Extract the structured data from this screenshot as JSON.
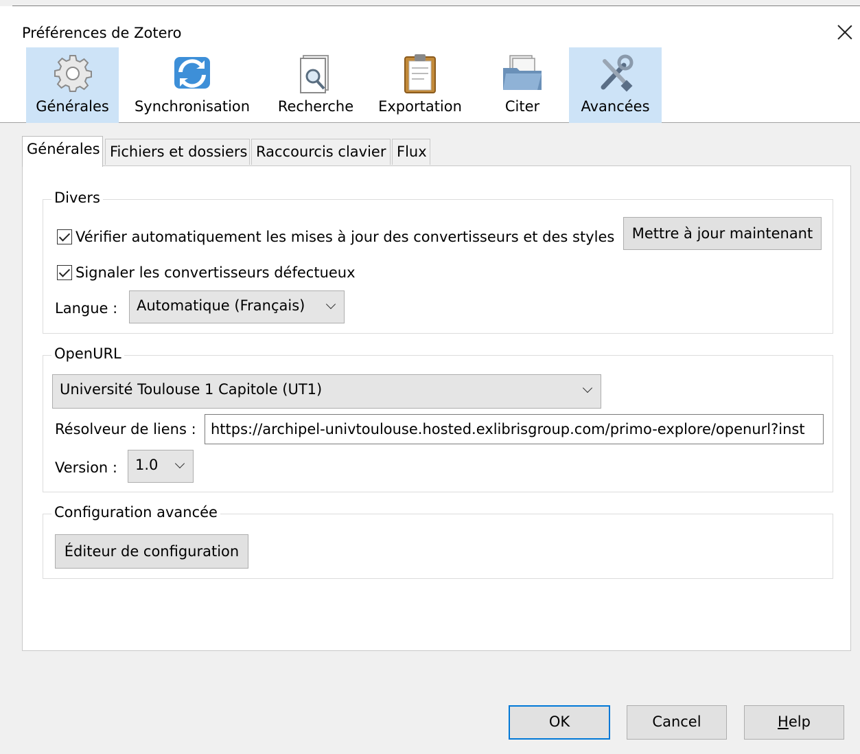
{
  "window": {
    "title": "Préférences de Zotero"
  },
  "panes": [
    {
      "label": "Générales",
      "icon": "gear-icon",
      "selected": true
    },
    {
      "label": "Synchronisation",
      "icon": "sync-icon",
      "selected": false
    },
    {
      "label": "Recherche",
      "icon": "search-document-icon",
      "selected": false
    },
    {
      "label": "Exportation",
      "icon": "clipboard-icon",
      "selected": false
    },
    {
      "label": "Citer",
      "icon": "folder-icon",
      "selected": false
    },
    {
      "label": "Avancées",
      "icon": "tools-icon",
      "selected": true
    }
  ],
  "tabs": [
    {
      "label": "Générales",
      "active": true
    },
    {
      "label": "Fichiers et dossiers",
      "active": false
    },
    {
      "label": "Raccourcis clavier",
      "active": false
    },
    {
      "label": "Flux",
      "active": false
    }
  ],
  "divers": {
    "legend": "Divers",
    "auto_update_label": "Vérifier automatiquement les mises à jour des convertisseurs et des styles",
    "auto_update_checked": true,
    "update_now_button": "Mettre à jour maintenant",
    "report_broken_label": "Signaler les convertisseurs défectueux",
    "report_broken_checked": true,
    "language_label": "Langue :",
    "language_value": "Automatique (Français)"
  },
  "openurl": {
    "legend": "OpenURL",
    "resolver_select": "Université Toulouse 1 Capitole (UT1)",
    "resolver_label": "Résolveur de liens :",
    "resolver_value": "https://archipel-univtoulouse.hosted.exlibrisgroup.com/primo-explore/openurl?inst",
    "version_label": "Version :",
    "version_value": "1.0"
  },
  "advanced_config": {
    "legend": "Configuration avancée",
    "editor_button": "Éditeur de configuration"
  },
  "footer": {
    "ok": "OK",
    "cancel": "Cancel",
    "help": "Help"
  },
  "colors": {
    "selected_pane": "#cde3f7",
    "default_button_border": "#0078d7"
  }
}
